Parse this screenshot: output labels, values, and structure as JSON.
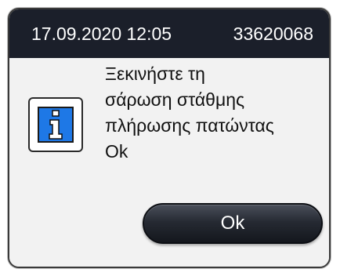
{
  "titlebar": {
    "datetime": "17.09.2020 12:05",
    "serial": "33620068"
  },
  "dialog": {
    "icon": "info-icon",
    "message": "Ξεκινήστε τη\nσάρωση στάθμης\nπλήρωσης πατώντας\nOk",
    "ok_label": "Ok"
  },
  "colors": {
    "titlebar_bg": "#1b1f2a",
    "dialog_bg": "#f2f2f2",
    "info_icon_bg": "#1e78e6",
    "button_bg": "#262a33"
  }
}
